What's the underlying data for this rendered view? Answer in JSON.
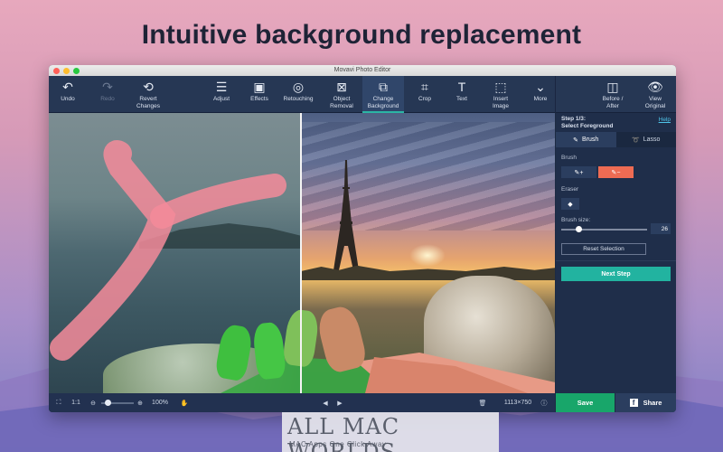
{
  "headline": "Intuitive background replacement",
  "window": {
    "title": "Movavi Photo Editor"
  },
  "colors": {
    "accent": "#22b3a0",
    "save": "#18a66a",
    "minus_brush": "#ee6b53",
    "toolbar_bg": "#263754"
  },
  "toolbar": {
    "undo": {
      "label": "Undo",
      "icon": "undo-icon"
    },
    "redo": {
      "label": "Redo",
      "icon": "redo-icon"
    },
    "revert_1": "Revert",
    "revert_2": "Changes",
    "adjust": "Adjust",
    "effects": "Effects",
    "retouching": "Retouching",
    "object_removal_1": "Object",
    "object_removal_2": "Removal",
    "change_bg_1": "Change",
    "change_bg_2": "Background",
    "crop": "Crop",
    "text": "Text",
    "insert_image_1": "Insert",
    "insert_image_2": "Image",
    "more": "More",
    "before_after_1": "Before /",
    "before_after_2": "After",
    "view_original_1": "View",
    "view_original_2": "Original"
  },
  "bottom": {
    "fit": "⛶",
    "ratio": "1:1",
    "zoom": "100%",
    "dimensions": "1113×750"
  },
  "side": {
    "step_1": "Step 1/3:",
    "step_2": "Select Foreground",
    "help": "Help",
    "tab_brush": "Brush",
    "tab_lasso": "Lasso",
    "brush_label": "Brush",
    "eraser_label": "Eraser",
    "brush_size_label": "Brush size:",
    "brush_size": "26",
    "reset": "Reset Selection",
    "next": "Next Step"
  },
  "actions": {
    "save": "Save",
    "share": "Share"
  },
  "watermark": {
    "main": "ALL MAC WORLDS",
    "sub": "MAC Apps One Click Away"
  }
}
